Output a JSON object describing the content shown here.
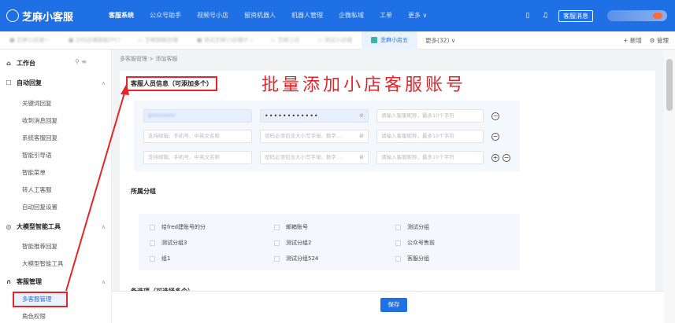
{
  "app": {
    "name": "芝麻小客服"
  },
  "topnav": {
    "items": [
      "客服系统",
      "公众号助手",
      "视频号小店",
      "留资机器人",
      "机器人管理",
      "企微私域",
      "工单",
      "更多 ∨"
    ],
    "active_index": 0,
    "message_button": "客服消息"
  },
  "tabs": {
    "active_label": "芝麻小店五",
    "more_label": "更多(32) ∨",
    "add_label": "+ 新增",
    "manage_label": "⚙ 管理"
  },
  "sidebar": {
    "workbench": "工作台",
    "auto_reply": {
      "title": "自动回复",
      "items": [
        "关键词回复",
        "收到消息回复",
        "系统客服回复",
        "智能引导语",
        "智能菜单",
        "转人工客服",
        "自动回复设置"
      ]
    },
    "ai_tools": {
      "title": "大模型智能工具",
      "items": [
        "智能推荐回复",
        "大模型智能工具"
      ]
    },
    "cs_manage": {
      "title": "客服管理",
      "items": [
        "多客服管理",
        "角色权限"
      ]
    }
  },
  "breadcrumb": {
    "parent": "多客服管理",
    "separator": ">",
    "current": "添加客服"
  },
  "annotation": "批量添加小店客服账号",
  "account_section": {
    "title": "客服人员信息（可添加多个）",
    "rows": [
      {
        "account": "1••••••••",
        "password": "••••••••••••",
        "nickname_placeholder": "请输入客服昵称，最多10个字符"
      },
      {
        "account_placeholder": "支持邮箱、手机号、中英文名称",
        "password_placeholder": "密码必须包含大小写字母、数字…",
        "nickname_placeholder": "请输入客服昵称，最多10个字符"
      },
      {
        "account_placeholder": "支持邮箱、手机号、中英文名称",
        "password_placeholder": "密码必须包含大小写字母、数字…",
        "nickname_placeholder": "请输入客服昵称，最多10个字符"
      }
    ]
  },
  "group_section": {
    "title": "所属分组",
    "groups": [
      "给fred建账号的分",
      "邮箱账号",
      "测试分组",
      "测试分组3",
      "测试分组2",
      "公众号售前",
      "组1",
      "测试分组524",
      "客服分组"
    ]
  },
  "next_section_partial": "备选项（可选择多个）",
  "save_label": "保存"
}
